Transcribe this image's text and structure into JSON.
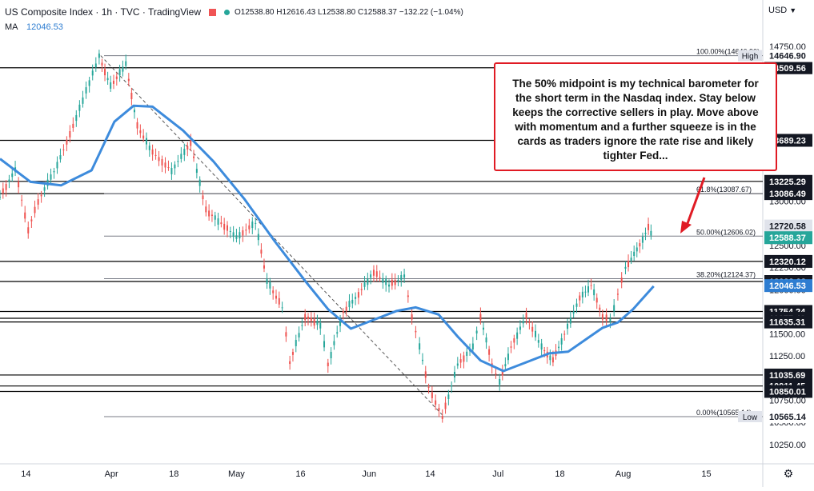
{
  "header": {
    "symbol_line": "US Composite Index · 1h · TVC · TradingView",
    "ohlc_text": "O12538.80 H12616.43 L12538.80 C12588.37 −132.22 (−1.04%)",
    "ma_label": "MA",
    "ma_value": "12046.53",
    "currency": "USD"
  },
  "annotation": {
    "text": "The 50% midpoint is my technical barometer for the short term in the Nasdaq index. Stay below keeps the corrective sellers in play. Move above with momentum and a further squeeze is in the cards as traders ignore the rate rise and likely tighter Fed..."
  },
  "colors": {
    "up": "#26a69a",
    "down": "#ef5350",
    "ma": "#3d8bdc",
    "annotation": "#e01b24",
    "label_bg": "#131722",
    "ma_label_bg": "#2e7dd1",
    "price_label_bg": "#26a69a"
  },
  "chart_data": {
    "type": "candlestick",
    "title": "US Composite Index · 1h · TVC",
    "ylim": [
      10140,
      14860
    ],
    "y_ticks": [
      "14750.00",
      "13250.00",
      "13000.00",
      "12750.00",
      "12500.00",
      "12250.00",
      "12000.00",
      "11750.00",
      "11500.00",
      "11250.00",
      "11000.00",
      "10750.00",
      "10500.00",
      "10250.00"
    ],
    "x_ticks": [
      "14",
      "Apr",
      "18",
      "May",
      "16",
      "Jun",
      "14",
      "Jul",
      "18",
      "Aug",
      "15"
    ],
    "x_tick_positions": [
      0.034,
      0.146,
      0.228,
      0.31,
      0.394,
      0.484,
      0.564,
      0.653,
      0.734,
      0.817,
      0.926
    ],
    "hlines": [
      {
        "label": "14509.56",
        "value": 14509.56
      },
      {
        "label": "13689.23",
        "value": 13689.23
      },
      {
        "label": "13225.29",
        "value": 13225.29
      },
      {
        "label": "13086.49",
        "value": 13086.49
      },
      {
        "label": "12320.12",
        "value": 12320.12
      },
      {
        "label": "12093.02",
        "value": 12093.02
      },
      {
        "label": "11754.24",
        "value": 11754.24
      },
      {
        "label": "11677.49",
        "value": 11677.49
      },
      {
        "label": "11635.31",
        "value": 11635.31
      },
      {
        "label": "11035.69",
        "value": 11035.69
      },
      {
        "label": "10911.45",
        "value": 10911.45
      },
      {
        "label": "10850.01",
        "value": 10850.01
      }
    ],
    "fib_levels": [
      {
        "label": "100.00%(14646.90)",
        "value": 14646.9
      },
      {
        "label": "61.8%(13087.67)",
        "value": 13087.67
      },
      {
        "label": "50.00%(12606.02)",
        "value": 12606.02
      },
      {
        "label": "38.20%(12124.37)",
        "value": 12124.37
      },
      {
        "label": "0.00%(10565.14)",
        "value": 10565.14
      }
    ],
    "price_labels": [
      {
        "label": "High",
        "value": 14646.9,
        "text": "14646.90"
      },
      {
        "label": "Low",
        "value": 10565.14,
        "text": "10565.14"
      },
      {
        "label": "",
        "value": 12720.58,
        "text": "12720.58"
      },
      {
        "label": "",
        "value": 12588.37,
        "text": "12588.37"
      },
      {
        "label": "MA",
        "value": 12046.53,
        "text": "12046.53"
      }
    ],
    "swing_points": [
      {
        "x": 0.0,
        "y": 13050
      },
      {
        "x": 0.02,
        "y": 13350
      },
      {
        "x": 0.037,
        "y": 12680
      },
      {
        "x": 0.05,
        "y": 13000
      },
      {
        "x": 0.075,
        "y": 13400
      },
      {
        "x": 0.1,
        "y": 13950
      },
      {
        "x": 0.13,
        "y": 14640
      },
      {
        "x": 0.145,
        "y": 14300
      },
      {
        "x": 0.165,
        "y": 14550
      },
      {
        "x": 0.18,
        "y": 13850
      },
      {
        "x": 0.2,
        "y": 13550
      },
      {
        "x": 0.225,
        "y": 13350
      },
      {
        "x": 0.25,
        "y": 13650
      },
      {
        "x": 0.27,
        "y": 12900
      },
      {
        "x": 0.29,
        "y": 12750
      },
      {
        "x": 0.31,
        "y": 12600
      },
      {
        "x": 0.335,
        "y": 12750
      },
      {
        "x": 0.35,
        "y": 12100
      },
      {
        "x": 0.37,
        "y": 11800
      },
      {
        "x": 0.38,
        "y": 11180
      },
      {
        "x": 0.4,
        "y": 11700
      },
      {
        "x": 0.42,
        "y": 11600
      },
      {
        "x": 0.43,
        "y": 11150
      },
      {
        "x": 0.45,
        "y": 11750
      },
      {
        "x": 0.47,
        "y": 11950
      },
      {
        "x": 0.49,
        "y": 12200
      },
      {
        "x": 0.51,
        "y": 12050
      },
      {
        "x": 0.53,
        "y": 12150
      },
      {
        "x": 0.54,
        "y": 11700
      },
      {
        "x": 0.55,
        "y": 11350
      },
      {
        "x": 0.562,
        "y": 10900
      },
      {
        "x": 0.58,
        "y": 10560
      },
      {
        "x": 0.6,
        "y": 11150
      },
      {
        "x": 0.62,
        "y": 11350
      },
      {
        "x": 0.63,
        "y": 11700
      },
      {
        "x": 0.645,
        "y": 11150
      },
      {
        "x": 0.655,
        "y": 10950
      },
      {
        "x": 0.67,
        "y": 11350
      },
      {
        "x": 0.69,
        "y": 11700
      },
      {
        "x": 0.71,
        "y": 11350
      },
      {
        "x": 0.725,
        "y": 11200
      },
      {
        "x": 0.74,
        "y": 11500
      },
      {
        "x": 0.76,
        "y": 11900
      },
      {
        "x": 0.775,
        "y": 12050
      },
      {
        "x": 0.79,
        "y": 11700
      },
      {
        "x": 0.8,
        "y": 11650
      },
      {
        "x": 0.81,
        "y": 11950
      },
      {
        "x": 0.82,
        "y": 12250
      },
      {
        "x": 0.835,
        "y": 12450
      },
      {
        "x": 0.85,
        "y": 12700
      },
      {
        "x": 0.857,
        "y": 12590
      }
    ],
    "ma_points": [
      {
        "x": 0.0,
        "y": 13480
      },
      {
        "x": 0.04,
        "y": 13220
      },
      {
        "x": 0.08,
        "y": 13180
      },
      {
        "x": 0.12,
        "y": 13350
      },
      {
        "x": 0.15,
        "y": 13900
      },
      {
        "x": 0.175,
        "y": 14080
      },
      {
        "x": 0.2,
        "y": 14070
      },
      {
        "x": 0.24,
        "y": 13800
      },
      {
        "x": 0.28,
        "y": 13450
      },
      {
        "x": 0.32,
        "y": 13030
      },
      {
        "x": 0.36,
        "y": 12550
      },
      {
        "x": 0.4,
        "y": 12100
      },
      {
        "x": 0.43,
        "y": 11780
      },
      {
        "x": 0.46,
        "y": 11560
      },
      {
        "x": 0.49,
        "y": 11660
      },
      {
        "x": 0.52,
        "y": 11760
      },
      {
        "x": 0.545,
        "y": 11800
      },
      {
        "x": 0.575,
        "y": 11720
      },
      {
        "x": 0.6,
        "y": 11470
      },
      {
        "x": 0.63,
        "y": 11200
      },
      {
        "x": 0.66,
        "y": 11080
      },
      {
        "x": 0.69,
        "y": 11180
      },
      {
        "x": 0.72,
        "y": 11280
      },
      {
        "x": 0.745,
        "y": 11300
      },
      {
        "x": 0.77,
        "y": 11450
      },
      {
        "x": 0.79,
        "y": 11570
      },
      {
        "x": 0.81,
        "y": 11630
      },
      {
        "x": 0.83,
        "y": 11780
      },
      {
        "x": 0.857,
        "y": 12040
      }
    ],
    "trendline": {
      "x0": 0.132,
      "y0": 14646.9,
      "x1": 0.582,
      "y1": 10565.14
    }
  }
}
